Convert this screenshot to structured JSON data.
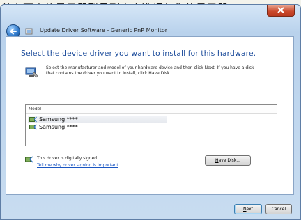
{
  "caption": "从右面中的显示器型号列表中选择与您的显示器",
  "window": {
    "title": "Update Driver Software - Generic PnP Monitor",
    "heading": "Select the device driver you want to install for this hardware.",
    "instructions": "Select the manufacturer and model of your hardware device and then click Next. If you have a disk that contains the driver you want to install, click Have Disk."
  },
  "model_list": {
    "header": "Model",
    "items": [
      {
        "label": "Samsung ****"
      },
      {
        "label": "Samsung ****"
      }
    ]
  },
  "signature": {
    "text": "This driver is digitally signed.",
    "link": "Tell me why driver signing is important"
  },
  "buttons": {
    "have_disk": "Have Disk...",
    "next": "Next",
    "cancel": "Cancel"
  },
  "colors": {
    "heading": "#1f4e9c",
    "link": "#1a56c2",
    "window_frame": "#b9d2ec",
    "close_button": "#c9472a"
  },
  "icons": {
    "back": "back-arrow-icon",
    "wizard": "update-driver-icon",
    "hardware": "hardware-device-icon",
    "driver": "driver-file-icon",
    "signed": "signed-driver-icon",
    "close": "close-icon"
  }
}
